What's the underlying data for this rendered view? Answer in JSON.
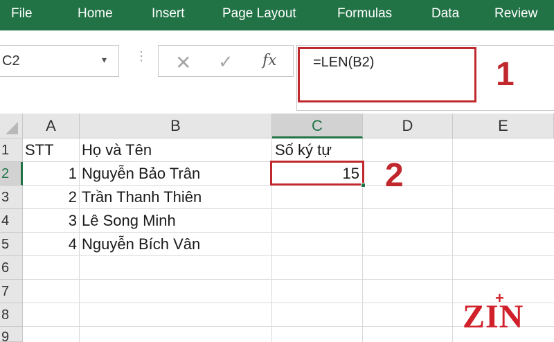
{
  "ribbon": {
    "tabs": [
      "File",
      "Home",
      "Insert",
      "Page Layout",
      "Formulas",
      "Data",
      "Review"
    ]
  },
  "formula_bar": {
    "name_box": "C2",
    "name_box_arrow": "▾",
    "dots": "⋮",
    "cancel_icon": "✕",
    "enter_icon": "✓",
    "fx_label": "fx",
    "formula": "=LEN(B2)"
  },
  "callouts": {
    "one": "1",
    "two": "2"
  },
  "sheet": {
    "columns": [
      "A",
      "B",
      "C",
      "D",
      "E"
    ],
    "selected_column": "C",
    "rows": [
      "1",
      "2",
      "3",
      "4",
      "5",
      "6",
      "7",
      "8",
      "9"
    ],
    "selected_row": "2",
    "cells": {
      "A1": "STT",
      "B1": "Họ và Tên",
      "C1": "Số ký tự",
      "A2": "1",
      "B2": "Nguyễn Bảo Trân",
      "C2": "15",
      "A3": "2",
      "B3": "Trần Thanh Thiên",
      "A4": "3",
      "B4": "Lê Song Minh",
      "A5": "4",
      "B5": "Nguyễn Bích Vân"
    }
  },
  "logo": {
    "text": "ZIN",
    "mark": "+"
  },
  "colors": {
    "ribbon": "#217346",
    "highlight": "#c0282d",
    "logo": "#d0202a"
  }
}
